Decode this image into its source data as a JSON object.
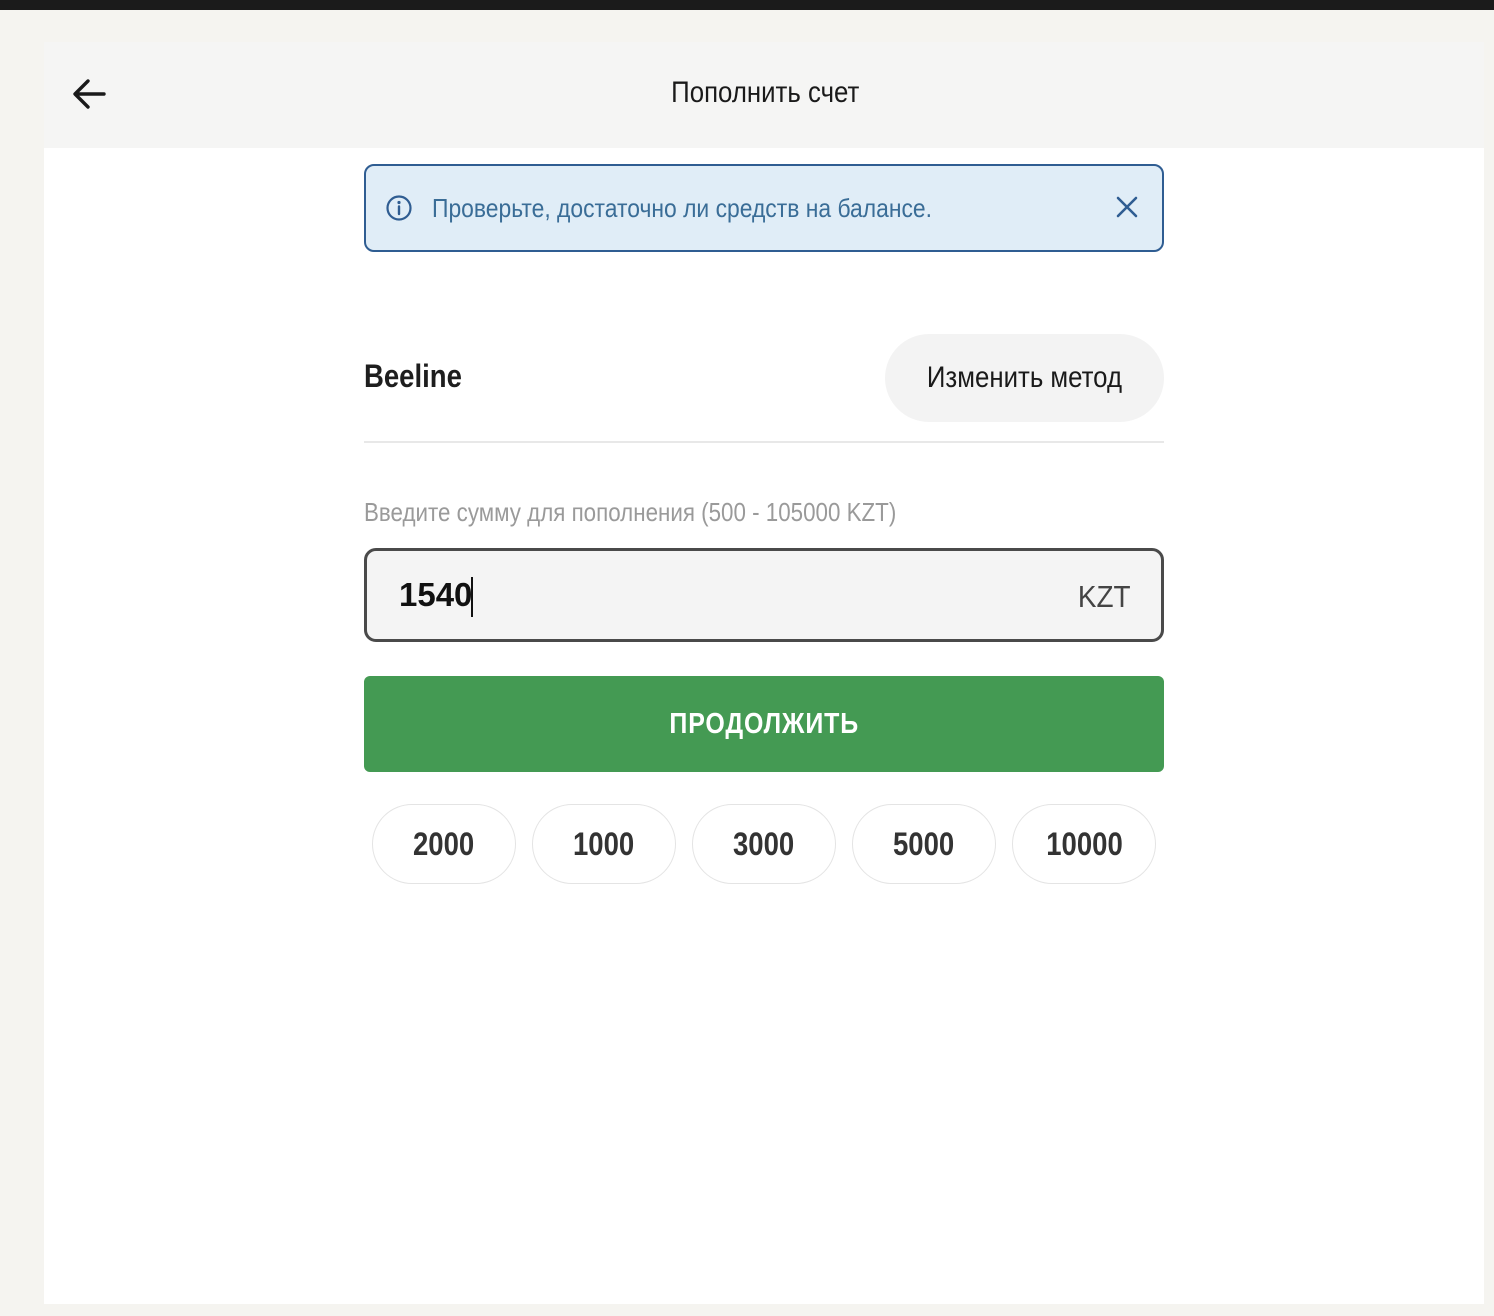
{
  "header": {
    "title": "Пополнить счет",
    "back_icon": "arrow-left-icon"
  },
  "notice": {
    "icon": "info-icon",
    "text": "Проверьте, достаточно ли средств на балансе.",
    "close_icon": "close-icon",
    "border_color": "#2f5d92",
    "background_color": "#e0edf7"
  },
  "method": {
    "name": "Beeline",
    "change_label": "Изменить метод"
  },
  "amount": {
    "label": "Введите сумму для пополнения (500 - 105000 KZT)",
    "value": "1540",
    "currency": "KZT"
  },
  "continue": {
    "label": "ПРОДОЛЖИТЬ",
    "color": "#449a53"
  },
  "quick_amounts": [
    "2000",
    "1000",
    "3000",
    "5000",
    "10000"
  ]
}
